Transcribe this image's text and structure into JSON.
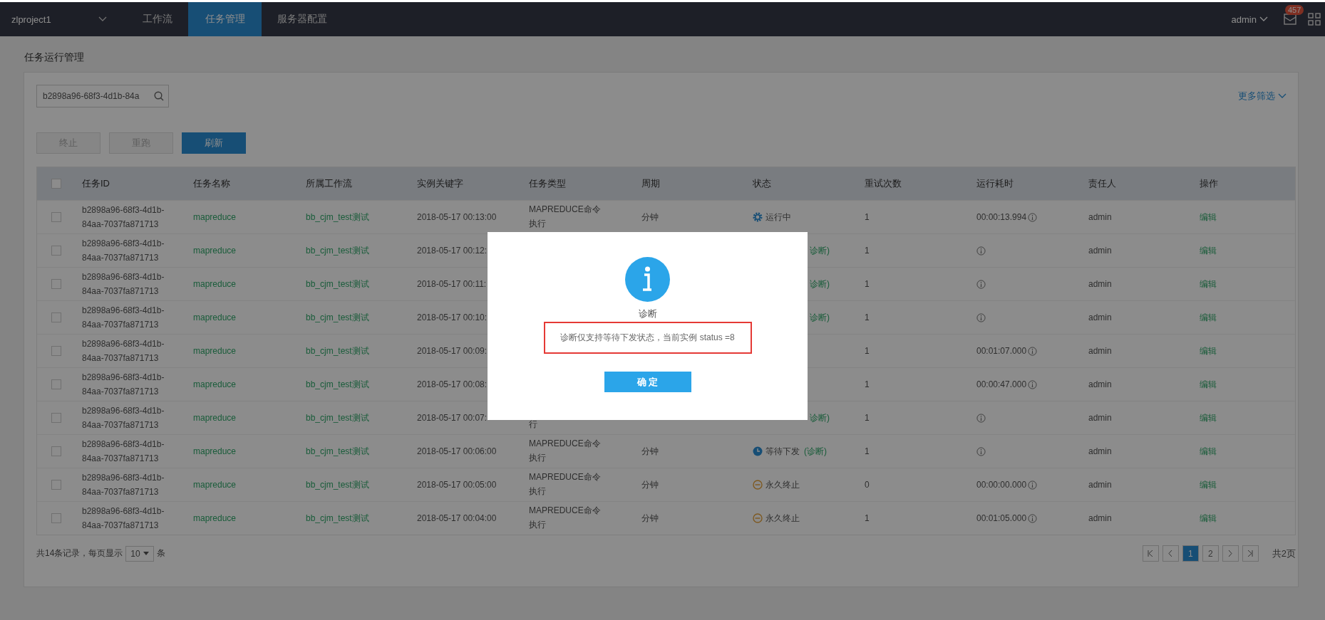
{
  "topbar": {
    "project": "zlproject1",
    "tabs": [
      {
        "label": "工作流",
        "selected": false
      },
      {
        "label": "任务管理",
        "selected": true
      },
      {
        "label": "服务器配置",
        "selected": false
      }
    ],
    "user": "admin",
    "badge": "457"
  },
  "page_title": "任务运行管理",
  "search": {
    "value": "b2898a96-68f3-4d1b-84a"
  },
  "more_filter": "更多筛选",
  "actions": [
    {
      "label": "终止",
      "disabled": true
    },
    {
      "label": "重跑",
      "disabled": true
    },
    {
      "label": "刷新",
      "disabled": false
    }
  ],
  "table": {
    "select_all": {
      "checked": false
    },
    "columns": [
      "任务ID",
      "任务名称",
      "所属工作流",
      "实例关键字",
      "任务类型",
      "周期",
      "状态",
      "重试次数",
      "运行耗时",
      "责任人",
      "操作"
    ],
    "rows": [
      {
        "checked": false,
        "id": "b2898a96-68f3-4d1b-84aa-7037fa871713",
        "name": "mapreduce",
        "workflow": "bb_cjm_test测试",
        "key": "2018-05-17 00:13:00",
        "type": "MAPREDUCE命令执行",
        "period": "分钟",
        "status": {
          "kind": "running",
          "text": "运行中"
        },
        "retry": "1",
        "duration": "00:00:13.994",
        "owner": "admin",
        "op": "编辑"
      },
      {
        "checked": false,
        "id": "b2898a96-68f3-4d1b-84aa-7037fa871713",
        "name": "mapreduce",
        "workflow": "bb_cjm_test测试",
        "key": "2018-05-17 00:12:",
        "status": {
          "diagnose": "诊断)"
        },
        "retry": "1",
        "owner": "admin",
        "op": "编辑"
      },
      {
        "checked": false,
        "id": "b2898a96-68f3-4d1b-84aa-7037fa871713",
        "name": "mapreduce",
        "workflow": "bb_cjm_test测试",
        "key": "2018-05-17 00:11:",
        "status": {
          "diagnose": "诊断)"
        },
        "retry": "1",
        "owner": "admin",
        "op": "编辑"
      },
      {
        "checked": false,
        "id": "b2898a96-68f3-4d1b-84aa-7037fa871713",
        "name": "mapreduce",
        "workflow": "bb_cjm_test测试",
        "key": "2018-05-17 00:10:",
        "status": {
          "diagnose": "诊断)"
        },
        "retry": "1",
        "owner": "admin",
        "op": "编辑"
      },
      {
        "checked": false,
        "id": "b2898a96-68f3-4d1b-84aa-7037fa871713",
        "name": "mapreduce",
        "workflow": "bb_cjm_test测试",
        "key": "2018-05-17 00:09:",
        "status": {},
        "retry": "1",
        "duration": "00:01:07.000",
        "owner": "admin",
        "op": "编辑"
      },
      {
        "checked": false,
        "id": "b2898a96-68f3-4d1b-84aa-7037fa871713",
        "name": "mapreduce",
        "workflow": "bb_cjm_test测试",
        "key": "2018-05-17 00:08:",
        "status": {},
        "retry": "1",
        "duration": "00:00:47.000",
        "owner": "admin",
        "op": "编辑"
      },
      {
        "checked": false,
        "id": "b2898a96-68f3-4d1b-84aa-7037fa871713",
        "name": "mapreduce",
        "workflow": "bb_cjm_test测试",
        "key": "2018-05-17 00:07:",
        "type": "行",
        "status": {
          "diagnose": "诊断)"
        },
        "retry": "1",
        "owner": "admin",
        "op": "编辑"
      },
      {
        "checked": false,
        "id": "b2898a96-68f3-4d1b-84aa-7037fa871713",
        "name": "mapreduce",
        "workflow": "bb_cjm_test测试",
        "key": "2018-05-17 00:06:00",
        "type": "MAPREDUCE命令执行",
        "period": "分钟",
        "status": {
          "kind": "waiting",
          "text": "等待下发",
          "diagnose": "(诊断)"
        },
        "retry": "1",
        "owner": "admin",
        "op": "编辑"
      },
      {
        "checked": false,
        "id": "b2898a96-68f3-4d1b-84aa-7037fa871713",
        "name": "mapreduce",
        "workflow": "bb_cjm_test测试",
        "key": "2018-05-17 00:05:00",
        "type": "MAPREDUCE命令执行",
        "period": "分钟",
        "status": {
          "kind": "stopped",
          "text": "永久终止"
        },
        "retry": "0",
        "duration": "00:00:00.000",
        "owner": "admin",
        "op": "编辑"
      },
      {
        "checked": false,
        "id": "b2898a96-68f3-4d1b-84aa-7037fa871713",
        "name": "mapreduce",
        "workflow": "bb_cjm_test测试",
        "key": "2018-05-17 00:04:00",
        "type": "MAPREDUCE命令执行",
        "period": "分钟",
        "status": {
          "kind": "stopped",
          "text": "永久终止"
        },
        "retry": "1",
        "duration": "00:01:05.000",
        "owner": "admin",
        "op": "编辑"
      }
    ]
  },
  "footer": {
    "summary": "共14条记录，每页显示",
    "page_size": "10",
    "unit": "条",
    "pages": [
      {
        "label": "1",
        "selected": true
      },
      {
        "label": "2",
        "selected": false
      }
    ],
    "total_pages": "共2页"
  },
  "dialog": {
    "title": "诊断",
    "message": "诊断仅支持等待下发状态，当前实例 status =8",
    "button": "确 定"
  }
}
